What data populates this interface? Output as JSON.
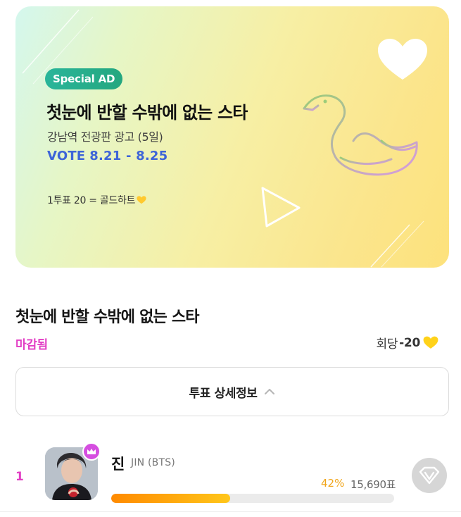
{
  "banner": {
    "badge": "Special AD",
    "title": "첫눈에 반할 수밖에 없는 스타",
    "subtitle": "강남역 전광판 광고 (5일)",
    "vote_label": "VOTE",
    "vote_dates": "8.21 - 8.25",
    "rate": "1투표 20 = 골드하트",
    "colors": {
      "badge": "#24a77f",
      "vote": "#3d64d8"
    },
    "icons": [
      "heart-icon",
      "swan-illustration",
      "play-triangle-icon",
      "gold-heart-icon"
    ]
  },
  "section": {
    "title": "첫눈에 반할 수밖에 없는 스타",
    "status": "마감됨",
    "cost_label": "회당",
    "cost_value": "-20",
    "detail_button": "투표 상세정보",
    "colors": {
      "status": "#e23ec4",
      "gold": "#ffd21a"
    }
  },
  "candidates": [
    {
      "rank": "1",
      "name": "진",
      "group": "JIN (BTS)",
      "percent_label": "42%",
      "percent": 42,
      "votes": "15,690표",
      "icons": [
        "crown-icon",
        "vote-v-icon"
      ]
    }
  ]
}
